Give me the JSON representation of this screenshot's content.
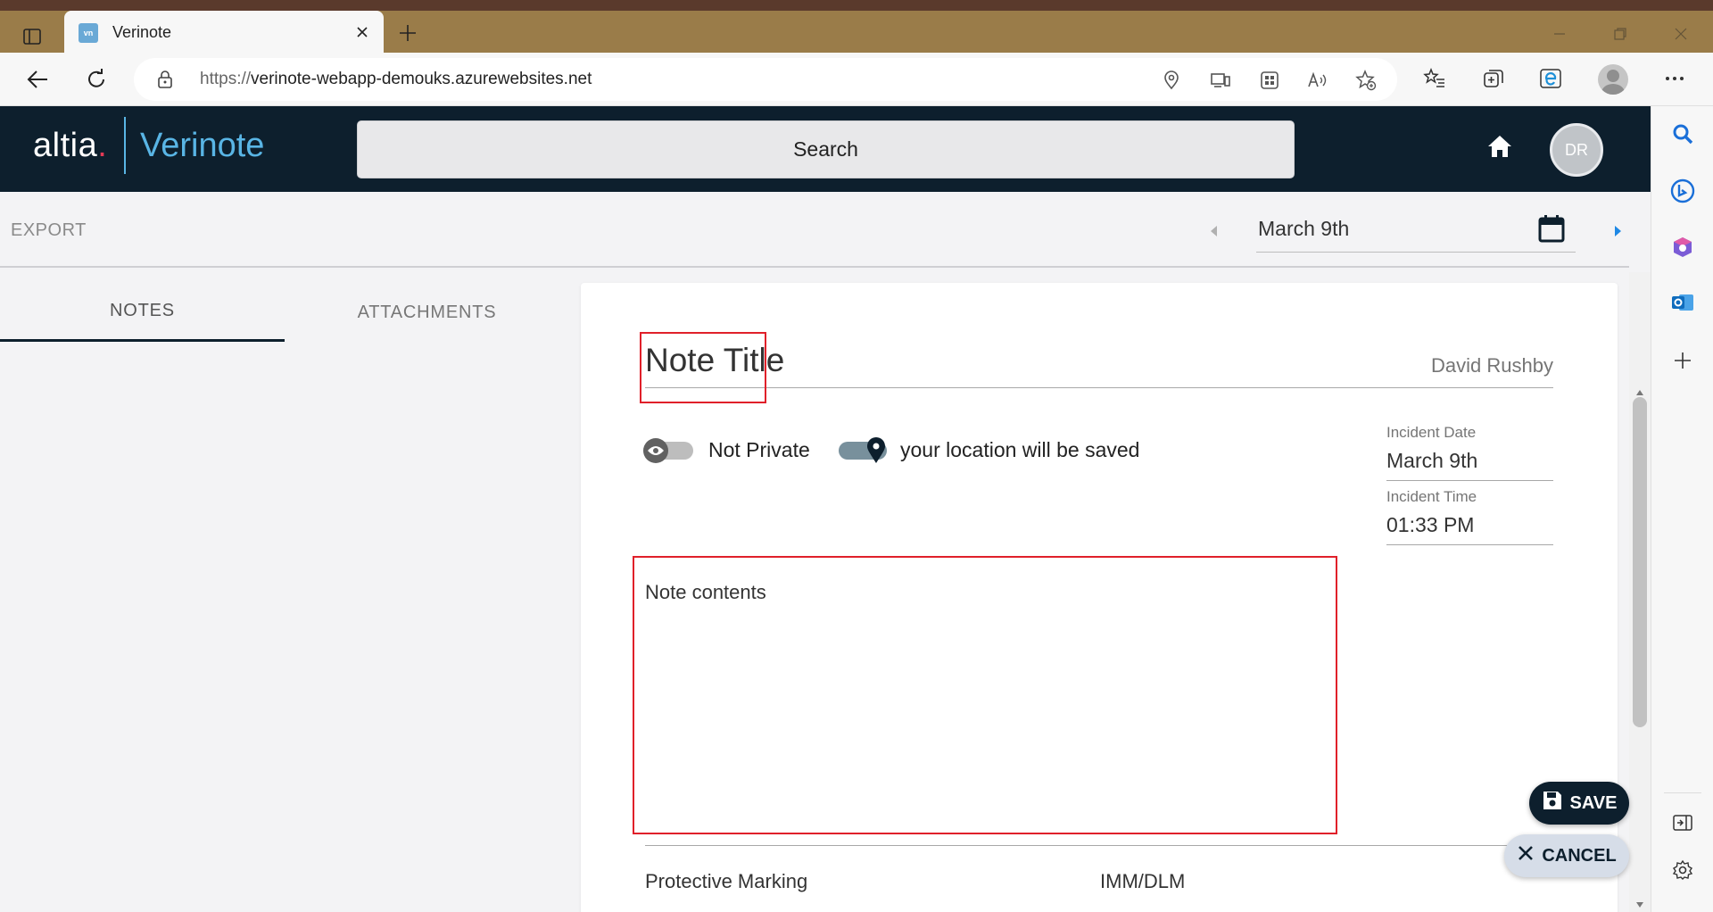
{
  "browser": {
    "tab_title": "Verinote",
    "favicon_text": "vn",
    "url_scheme": "https://",
    "url_host": "verinote-webapp-demouks.azurewebsites.net"
  },
  "app": {
    "logo_primary": "altia",
    "logo_dot": ".",
    "logo_secondary": "Verinote",
    "search_label": "Search",
    "user_initials": "DR",
    "colors": {
      "header_bg": "#0d1f2d",
      "brand_blue": "#59b5e5",
      "highlight_red": "#e0202a"
    }
  },
  "toolbar": {
    "export_label": "EXPORT",
    "date_value": "March 9th"
  },
  "tabs": [
    {
      "label": "NOTES",
      "active": true
    },
    {
      "label": "ATTACHMENTS",
      "active": false
    }
  ],
  "note": {
    "title_placeholder": "Note Title",
    "author": "David Rushby",
    "privacy_label": "Not Private",
    "location_label": "your location will be saved",
    "incident_date_label": "Incident Date",
    "incident_date_value": "March 9th",
    "incident_time_label": "Incident Time",
    "incident_time_value": "01:33 PM",
    "contents_placeholder": "Note contents",
    "protective_marking_label": "Protective Marking",
    "protective_marking_value": "IMM/DLM"
  },
  "actions": {
    "save_label": "SAVE",
    "cancel_label": "CANCEL"
  }
}
